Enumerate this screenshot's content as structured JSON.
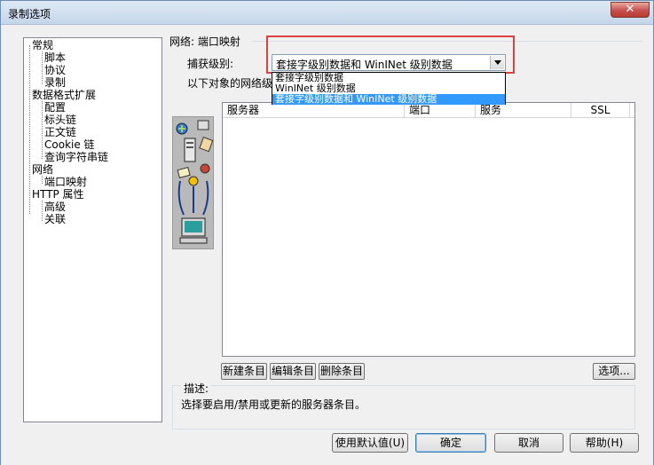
{
  "window": {
    "title": "录制选项",
    "close_glyph": "✕"
  },
  "tree": {
    "items": [
      {
        "label": "常规",
        "level": 0
      },
      {
        "label": "脚本",
        "level": 1
      },
      {
        "label": "协议",
        "level": 1
      },
      {
        "label": "录制",
        "level": 1
      },
      {
        "label": "数据格式扩展",
        "level": 0
      },
      {
        "label": "配置",
        "level": 1
      },
      {
        "label": "标头链",
        "level": 1
      },
      {
        "label": "正文链",
        "level": 1
      },
      {
        "label": "Cookie 链",
        "level": 1
      },
      {
        "label": "查询字符串链",
        "level": 1
      },
      {
        "label": "网络",
        "level": 0
      },
      {
        "label": "端口映射",
        "level": 1
      },
      {
        "label": "HTTP 属性",
        "level": 0
      },
      {
        "label": "高级",
        "level": 1
      },
      {
        "label": "关联",
        "level": 1
      }
    ]
  },
  "panel": {
    "group_title": "网络: 端口映射",
    "capture_label": "捕获级别:",
    "capture_value": "套接字级别数据和 WinINet 级别数据",
    "capture_options": [
      {
        "label": "套接字级别数据",
        "selected": false
      },
      {
        "label": "WinINet 级别数据",
        "selected": false
      },
      {
        "label": "套接字级别数据和 WinINet 级别数据",
        "selected": true
      }
    ],
    "objects_label": "以下对象的网络级",
    "columns": [
      "服务器",
      "端口",
      "服务",
      "SSL"
    ],
    "buttons": {
      "new_entry": "新建条目",
      "edit_entry": "编辑条目",
      "delete_entry": "删除条目",
      "options": "选项..."
    },
    "description_title": "描述:",
    "description_text": "选择要启用/禁用或更新的服务器条目。"
  },
  "footer": {
    "use_defaults": "使用默认值(U)",
    "ok": "确定",
    "cancel": "取消",
    "help": "帮助(H)"
  }
}
